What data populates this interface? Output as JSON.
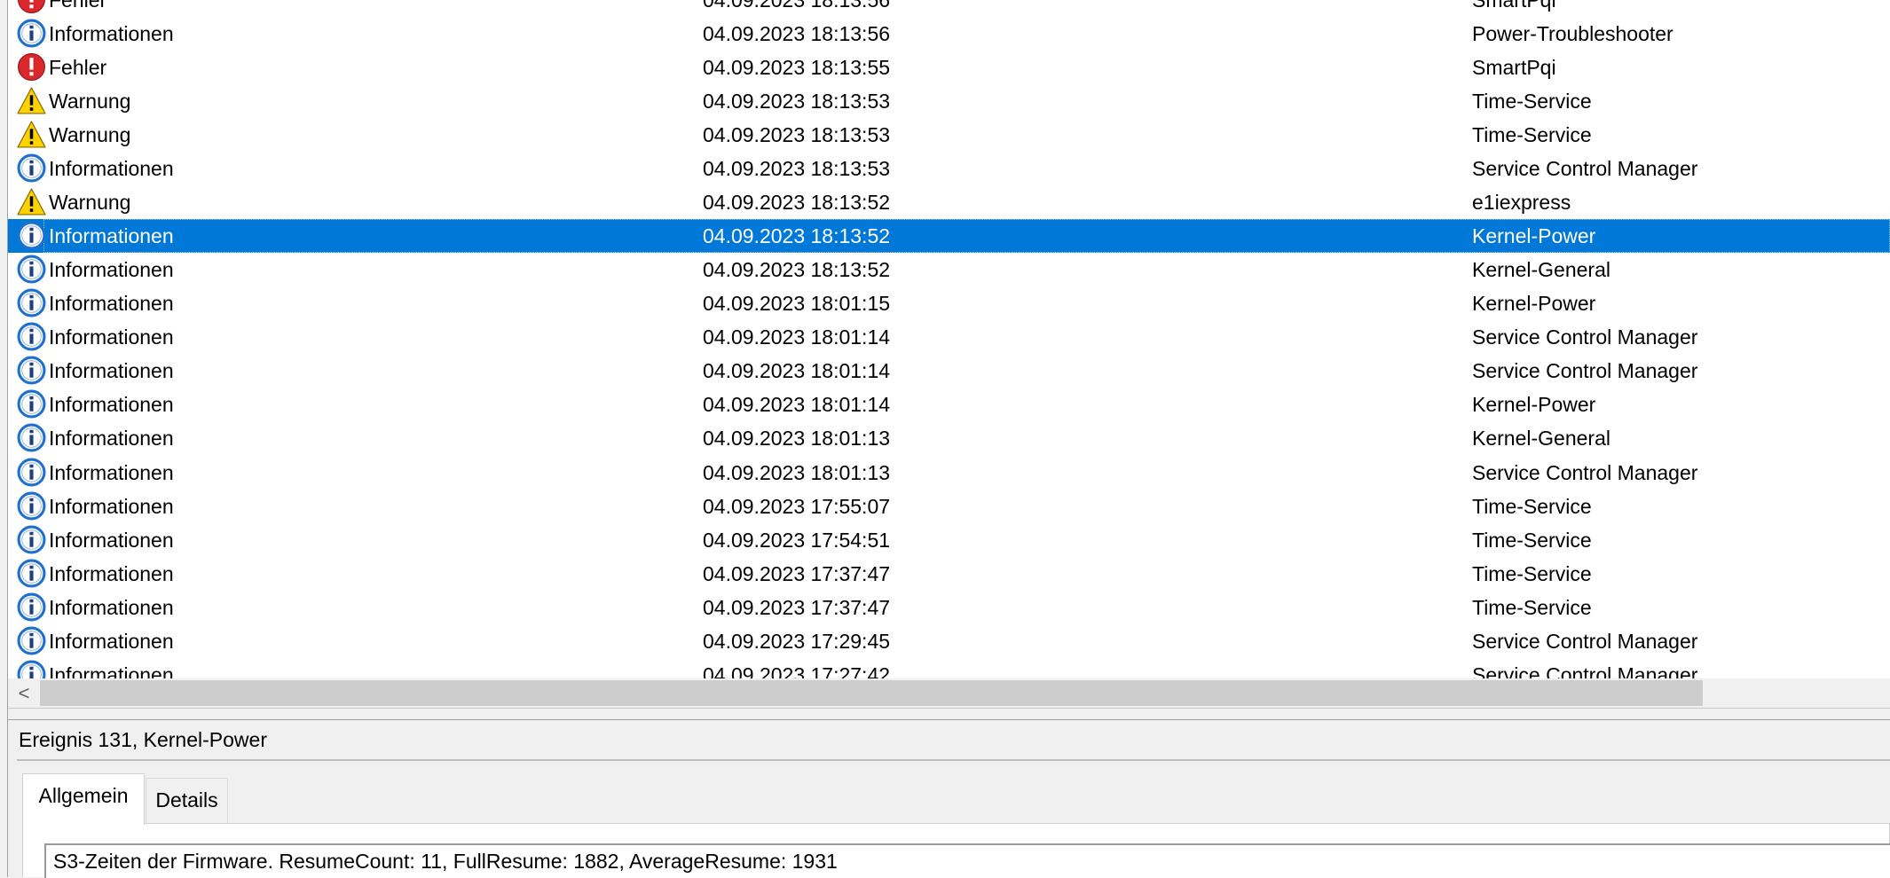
{
  "icons": {
    "info": "info-icon",
    "error": "error-icon",
    "warning": "warning-icon"
  },
  "colors": {
    "selection": "#0078d7",
    "info_ring": "#1e6fcf",
    "error_red": "#d9282b",
    "warning_yellow": "#ffd200"
  },
  "events": [
    {
      "level": "Fehler",
      "date": "04.09.2023 18:13:56",
      "source": "SmartPqi",
      "icon": "error"
    },
    {
      "level": "Informationen",
      "date": "04.09.2023 18:13:56",
      "source": "Power-Troubleshooter",
      "icon": "info"
    },
    {
      "level": "Fehler",
      "date": "04.09.2023 18:13:55",
      "source": "SmartPqi",
      "icon": "error"
    },
    {
      "level": "Warnung",
      "date": "04.09.2023 18:13:53",
      "source": "Time-Service",
      "icon": "warning"
    },
    {
      "level": "Warnung",
      "date": "04.09.2023 18:13:53",
      "source": "Time-Service",
      "icon": "warning"
    },
    {
      "level": "Informationen",
      "date": "04.09.2023 18:13:53",
      "source": "Service Control Manager",
      "icon": "info"
    },
    {
      "level": "Warnung",
      "date": "04.09.2023 18:13:52",
      "source": "e1iexpress",
      "icon": "warning"
    },
    {
      "level": "Informationen",
      "date": "04.09.2023 18:13:52",
      "source": "Kernel-Power",
      "icon": "info",
      "selected": true
    },
    {
      "level": "Informationen",
      "date": "04.09.2023 18:13:52",
      "source": "Kernel-General",
      "icon": "info"
    },
    {
      "level": "Informationen",
      "date": "04.09.2023 18:01:15",
      "source": "Kernel-Power",
      "icon": "info"
    },
    {
      "level": "Informationen",
      "date": "04.09.2023 18:01:14",
      "source": "Service Control Manager",
      "icon": "info"
    },
    {
      "level": "Informationen",
      "date": "04.09.2023 18:01:14",
      "source": "Service Control Manager",
      "icon": "info"
    },
    {
      "level": "Informationen",
      "date": "04.09.2023 18:01:14",
      "source": "Kernel-Power",
      "icon": "info"
    },
    {
      "level": "Informationen",
      "date": "04.09.2023 18:01:13",
      "source": "Kernel-General",
      "icon": "info"
    },
    {
      "level": "Informationen",
      "date": "04.09.2023 18:01:13",
      "source": "Service Control Manager",
      "icon": "info"
    },
    {
      "level": "Informationen",
      "date": "04.09.2023 17:55:07",
      "source": "Time-Service",
      "icon": "info"
    },
    {
      "level": "Informationen",
      "date": "04.09.2023 17:54:51",
      "source": "Time-Service",
      "icon": "info"
    },
    {
      "level": "Informationen",
      "date": "04.09.2023 17:37:47",
      "source": "Time-Service",
      "icon": "info"
    },
    {
      "level": "Informationen",
      "date": "04.09.2023 17:37:47",
      "source": "Time-Service",
      "icon": "info"
    },
    {
      "level": "Informationen",
      "date": "04.09.2023 17:29:45",
      "source": "Service Control Manager",
      "icon": "info"
    },
    {
      "level": "Informationen",
      "date": "04.09.2023 17:27:42",
      "source": "Service Control Manager",
      "icon": "info"
    }
  ],
  "scrollbar": {
    "left_arrow": "<"
  },
  "detail": {
    "title": "Ereignis 131, Kernel-Power",
    "tabs": {
      "general": "Allgemein",
      "details": "Details"
    },
    "message": "S3-Zeiten der Firmware. ResumeCount: 11, FullResume: 1882, AverageResume: 1931"
  }
}
